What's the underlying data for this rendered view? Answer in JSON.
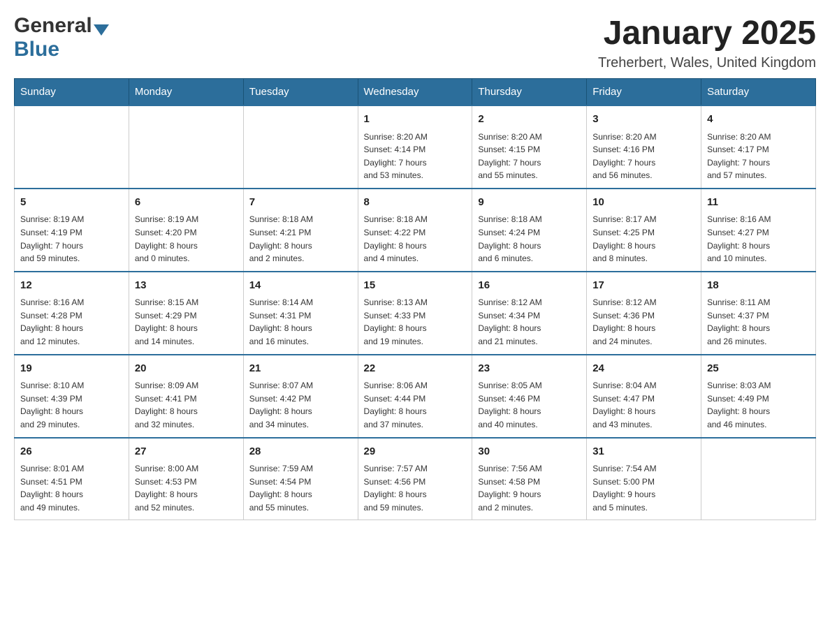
{
  "header": {
    "logo_general": "General",
    "logo_blue": "Blue",
    "month_title": "January 2025",
    "location": "Treherbert, Wales, United Kingdom"
  },
  "days_of_week": [
    "Sunday",
    "Monday",
    "Tuesday",
    "Wednesday",
    "Thursday",
    "Friday",
    "Saturday"
  ],
  "weeks": [
    [
      {
        "day": "",
        "info": ""
      },
      {
        "day": "",
        "info": ""
      },
      {
        "day": "",
        "info": ""
      },
      {
        "day": "1",
        "info": "Sunrise: 8:20 AM\nSunset: 4:14 PM\nDaylight: 7 hours\nand 53 minutes."
      },
      {
        "day": "2",
        "info": "Sunrise: 8:20 AM\nSunset: 4:15 PM\nDaylight: 7 hours\nand 55 minutes."
      },
      {
        "day": "3",
        "info": "Sunrise: 8:20 AM\nSunset: 4:16 PM\nDaylight: 7 hours\nand 56 minutes."
      },
      {
        "day": "4",
        "info": "Sunrise: 8:20 AM\nSunset: 4:17 PM\nDaylight: 7 hours\nand 57 minutes."
      }
    ],
    [
      {
        "day": "5",
        "info": "Sunrise: 8:19 AM\nSunset: 4:19 PM\nDaylight: 7 hours\nand 59 minutes."
      },
      {
        "day": "6",
        "info": "Sunrise: 8:19 AM\nSunset: 4:20 PM\nDaylight: 8 hours\nand 0 minutes."
      },
      {
        "day": "7",
        "info": "Sunrise: 8:18 AM\nSunset: 4:21 PM\nDaylight: 8 hours\nand 2 minutes."
      },
      {
        "day": "8",
        "info": "Sunrise: 8:18 AM\nSunset: 4:22 PM\nDaylight: 8 hours\nand 4 minutes."
      },
      {
        "day": "9",
        "info": "Sunrise: 8:18 AM\nSunset: 4:24 PM\nDaylight: 8 hours\nand 6 minutes."
      },
      {
        "day": "10",
        "info": "Sunrise: 8:17 AM\nSunset: 4:25 PM\nDaylight: 8 hours\nand 8 minutes."
      },
      {
        "day": "11",
        "info": "Sunrise: 8:16 AM\nSunset: 4:27 PM\nDaylight: 8 hours\nand 10 minutes."
      }
    ],
    [
      {
        "day": "12",
        "info": "Sunrise: 8:16 AM\nSunset: 4:28 PM\nDaylight: 8 hours\nand 12 minutes."
      },
      {
        "day": "13",
        "info": "Sunrise: 8:15 AM\nSunset: 4:29 PM\nDaylight: 8 hours\nand 14 minutes."
      },
      {
        "day": "14",
        "info": "Sunrise: 8:14 AM\nSunset: 4:31 PM\nDaylight: 8 hours\nand 16 minutes."
      },
      {
        "day": "15",
        "info": "Sunrise: 8:13 AM\nSunset: 4:33 PM\nDaylight: 8 hours\nand 19 minutes."
      },
      {
        "day": "16",
        "info": "Sunrise: 8:12 AM\nSunset: 4:34 PM\nDaylight: 8 hours\nand 21 minutes."
      },
      {
        "day": "17",
        "info": "Sunrise: 8:12 AM\nSunset: 4:36 PM\nDaylight: 8 hours\nand 24 minutes."
      },
      {
        "day": "18",
        "info": "Sunrise: 8:11 AM\nSunset: 4:37 PM\nDaylight: 8 hours\nand 26 minutes."
      }
    ],
    [
      {
        "day": "19",
        "info": "Sunrise: 8:10 AM\nSunset: 4:39 PM\nDaylight: 8 hours\nand 29 minutes."
      },
      {
        "day": "20",
        "info": "Sunrise: 8:09 AM\nSunset: 4:41 PM\nDaylight: 8 hours\nand 32 minutes."
      },
      {
        "day": "21",
        "info": "Sunrise: 8:07 AM\nSunset: 4:42 PM\nDaylight: 8 hours\nand 34 minutes."
      },
      {
        "day": "22",
        "info": "Sunrise: 8:06 AM\nSunset: 4:44 PM\nDaylight: 8 hours\nand 37 minutes."
      },
      {
        "day": "23",
        "info": "Sunrise: 8:05 AM\nSunset: 4:46 PM\nDaylight: 8 hours\nand 40 minutes."
      },
      {
        "day": "24",
        "info": "Sunrise: 8:04 AM\nSunset: 4:47 PM\nDaylight: 8 hours\nand 43 minutes."
      },
      {
        "day": "25",
        "info": "Sunrise: 8:03 AM\nSunset: 4:49 PM\nDaylight: 8 hours\nand 46 minutes."
      }
    ],
    [
      {
        "day": "26",
        "info": "Sunrise: 8:01 AM\nSunset: 4:51 PM\nDaylight: 8 hours\nand 49 minutes."
      },
      {
        "day": "27",
        "info": "Sunrise: 8:00 AM\nSunset: 4:53 PM\nDaylight: 8 hours\nand 52 minutes."
      },
      {
        "day": "28",
        "info": "Sunrise: 7:59 AM\nSunset: 4:54 PM\nDaylight: 8 hours\nand 55 minutes."
      },
      {
        "day": "29",
        "info": "Sunrise: 7:57 AM\nSunset: 4:56 PM\nDaylight: 8 hours\nand 59 minutes."
      },
      {
        "day": "30",
        "info": "Sunrise: 7:56 AM\nSunset: 4:58 PM\nDaylight: 9 hours\nand 2 minutes."
      },
      {
        "day": "31",
        "info": "Sunrise: 7:54 AM\nSunset: 5:00 PM\nDaylight: 9 hours\nand 5 minutes."
      },
      {
        "day": "",
        "info": ""
      }
    ]
  ]
}
